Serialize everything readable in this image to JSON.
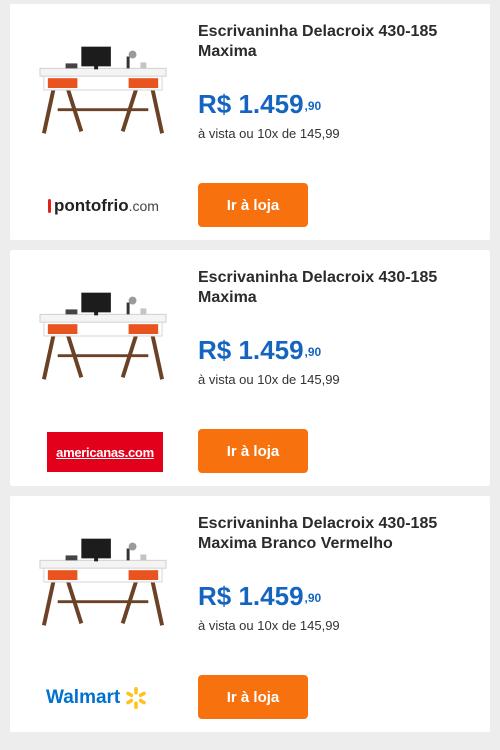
{
  "colors": {
    "price_blue": "#1565c0",
    "button_orange": "#f7720e",
    "page_background": "#ededed",
    "americanas_red": "#e3001b",
    "walmart_blue": "#0071ce",
    "walmart_spark": "#ffc220"
  },
  "offers": [
    {
      "title": "Escrivaninha Delacroix 430-185 Maxima",
      "price_main": "R$ 1.459",
      "price_cents": ",90",
      "installments": "à vista ou 10x de 145,99",
      "button_label": "Ir à loja",
      "store": {
        "logo_bold": "pontofrio",
        "logo_suffix": ".com",
        "icon": "pontofrio-logo"
      },
      "image_icon": "desk-image"
    },
    {
      "title": "Escrivaninha Delacroix 430-185 Maxima",
      "price_main": "R$ 1.459",
      "price_cents": ",90",
      "installments": "à vista ou 10x de 145,99",
      "button_label": "Ir à loja",
      "store": {
        "logo_text": "americanas.com",
        "icon": "americanas-logo"
      },
      "image_icon": "desk-image"
    },
    {
      "title": "Escrivaninha Delacroix 430-185 Maxima Branco Vermelho",
      "price_main": "R$ 1.459",
      "price_cents": ",90",
      "installments": "à vista ou 10x de 145,99",
      "button_label": "Ir à loja",
      "store": {
        "logo_text": "Walmart",
        "icon": "walmart-spark-icon"
      },
      "image_icon": "desk-image"
    }
  ]
}
